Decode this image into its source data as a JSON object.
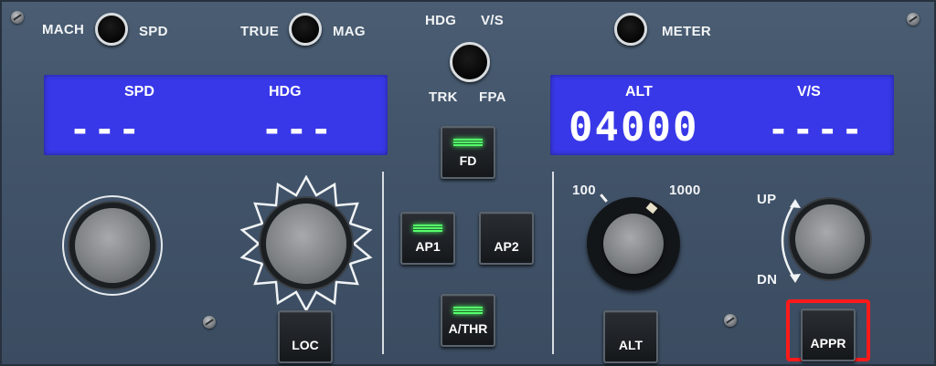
{
  "toggles": {
    "mach_label": "MACH",
    "spd_label": "SPD",
    "true_label": "TRUE",
    "mag_label": "MAG",
    "hdg_label": "HDG",
    "vs_label": "V/S",
    "trk_label": "TRK",
    "fpa_label": "FPA",
    "meter_label": "METER"
  },
  "left_display": {
    "spd_title": "SPD",
    "hdg_title": "HDG",
    "spd_value": "---",
    "hdg_value": "---"
  },
  "right_display": {
    "alt_title": "ALT",
    "vs_title": "V/S",
    "alt_value": "04000",
    "vs_value": "----"
  },
  "buttons": {
    "fd": "FD",
    "ap1": "AP1",
    "ap2": "AP2",
    "athr": "A/THR",
    "loc": "LOC",
    "alt": "ALT",
    "appr": "APPR"
  },
  "alt_selector": {
    "label_100": "100",
    "label_1000": "1000"
  },
  "vs_selector": {
    "up_label": "UP",
    "dn_label": "DN"
  },
  "colors": {
    "lcd_blue": "#3838e8",
    "led_green": "#57ff6d",
    "highlight_red": "#ff1a1a"
  }
}
